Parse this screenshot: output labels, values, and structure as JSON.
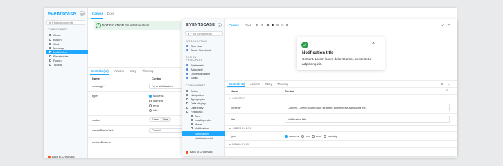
{
  "back": {
    "logo": "eventscase",
    "search_placeholder": "Find components",
    "section_components": "COMPONENTS",
    "nav": [
      "About",
      "Button",
      "Chat",
      "Message",
      "Notification",
      "Placeholder",
      "Popup",
      "Toolbar"
    ],
    "tabs": [
      "Canvas",
      "Docs"
    ],
    "notification_text": "NOTIFICATION  I'm a Notification!",
    "addon_tabs": [
      "Controls (12)",
      "Actions",
      "Story",
      "Theming"
    ],
    "controls": [
      {
        "name": "Name",
        "value": "Control"
      },
      {
        "name": "message*",
        "value": "I'm a Notification!"
      },
      {
        "name": "type*",
        "options": [
          "success",
          "warning",
          "error",
          "info"
        ]
      },
      {
        "name": "visible*",
        "bool": [
          "False",
          "True"
        ]
      },
      {
        "name": "cancelButtonText",
        "value": "Cancel"
      },
      {
        "name": "customButtons",
        "value": ""
      }
    ],
    "back_to": "Back to Chromatic"
  },
  "front": {
    "logo": "EVENTSCASE",
    "search_placeholder": "Find components",
    "tabs": [
      "Canvas",
      "Docs",
      "Story",
      "Theming"
    ],
    "sections": {
      "introduction": "INTRODUCTION",
      "design": "DESIGN PRINCIPLES",
      "components": "COMPONENTS"
    },
    "intro_items": [
      "Overview",
      "About Storybook"
    ],
    "design_items": [
      "Systematic",
      "Adaptable",
      "Understandable",
      "Smart"
    ],
    "comp_items": [
      "Action",
      "Navigation",
      "Typography",
      "Data display",
      "Data entry",
      "Feedback"
    ],
    "feedback_children": [
      "Alert",
      "Loadingorder",
      "Modal",
      "Notification"
    ],
    "notification_children": [
      "Notification",
      "NotificationList"
    ],
    "back_to": "Back to Chromatic",
    "toast": {
      "title": "Notification title",
      "body": "Content. Lorem ipsum dolor sit amet, consectetur adipiscing elit."
    },
    "addon_tabs": [
      "Controls (6)",
      "Actions",
      "Story",
      "Theming"
    ],
    "name_label": "Name",
    "control_label": "Control",
    "section_content": "CONTENT",
    "content_label": "content*",
    "content_value": "Content. Lorem ipsum dolor sit amet, consectetur adipiscing elit.",
    "title_label": "title",
    "title_value": "Notification title",
    "section_appearance": "APPEARANCE",
    "type_label": "type",
    "type_options": [
      "success",
      "info",
      "error",
      "warning"
    ],
    "section_behaviour": "BEHAVIOUR"
  },
  "colors": {
    "accent": "#1ea7fd",
    "success": "#2e9e4f",
    "notif_bg": "#e7f4ec"
  }
}
